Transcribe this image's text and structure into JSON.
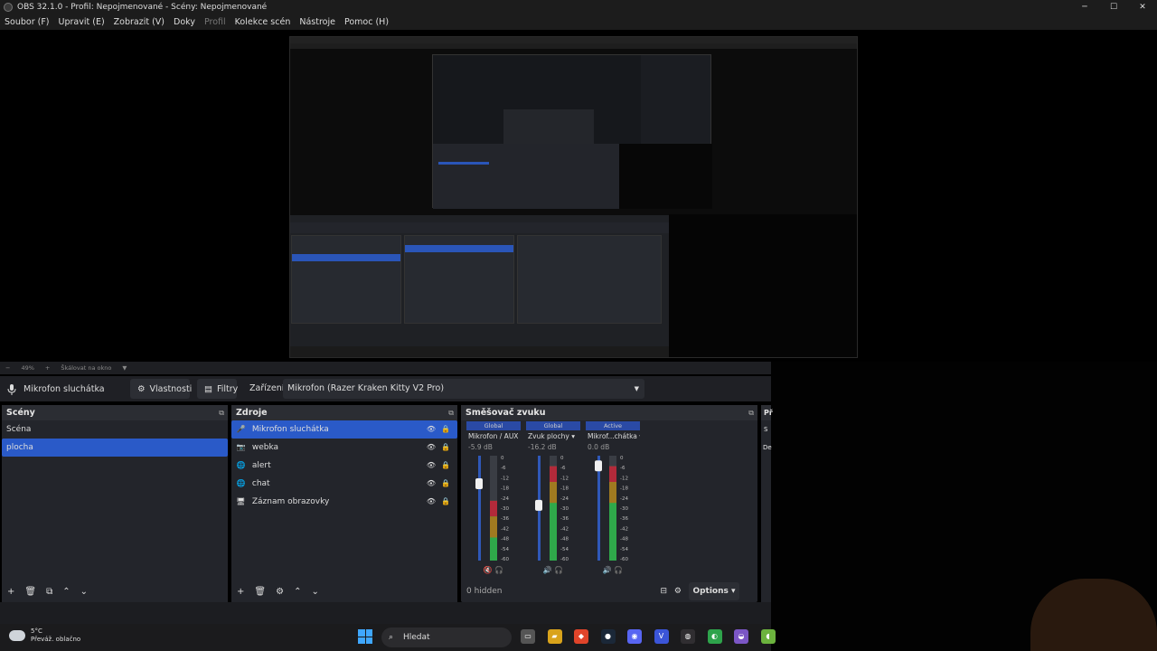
{
  "window": {
    "title": "OBS 32.1.0 - Profil: Nepojmenované - Scény: Nepojmenované",
    "controls": [
      "─",
      "☐",
      "✕"
    ]
  },
  "menu": [
    {
      "label": "Soubor (F)",
      "dim": false
    },
    {
      "label": "Upravit (E)",
      "dim": false
    },
    {
      "label": "Zobrazit (V)",
      "dim": false
    },
    {
      "label": "Doky",
      "dim": false
    },
    {
      "label": "Profil",
      "dim": true
    },
    {
      "label": "Kolekce scén",
      "dim": false
    },
    {
      "label": "Nástroje",
      "dim": false
    },
    {
      "label": "Pomoc (H)",
      "dim": false
    }
  ],
  "zoom": {
    "minus": "−",
    "value": "49%",
    "plus": "+",
    "mode": "Škálovat na okno"
  },
  "source_toolbar": {
    "selected_source": "Mikrofon sluchátka",
    "properties": "Vlastnosti",
    "filters": "Filtry",
    "device_label": "Zařízení",
    "device_value": "Mikrofon (Razer Kraken Kitty V2 Pro)"
  },
  "scenes": {
    "title": "Scény",
    "items": [
      {
        "label": "Scéna",
        "selected": false
      },
      {
        "label": "plocha",
        "selected": true
      }
    ],
    "footer": [
      "+",
      "🗑",
      "⧉",
      "⌃",
      "⌄"
    ]
  },
  "sources": {
    "title": "Zdroje",
    "items": [
      {
        "label": "Mikrofon sluchátka",
        "icon": "mic-icon",
        "glyph": "🎤",
        "selected": true
      },
      {
        "label": "webka",
        "icon": "camera-icon",
        "glyph": "📷",
        "selected": false
      },
      {
        "label": "alert",
        "icon": "browser-icon",
        "glyph": "🌐",
        "selected": false
      },
      {
        "label": "chat",
        "icon": "browser-icon",
        "glyph": "🌐",
        "selected": false
      },
      {
        "label": "Záznam obrazovky",
        "icon": "monitor-icon",
        "glyph": "🖥",
        "selected": false
      }
    ],
    "footer": [
      "+",
      "🗑",
      "⚙",
      "⌃",
      "⌄"
    ]
  },
  "mixer": {
    "title": "Směšovač zvuku",
    "channels": [
      {
        "tag": "Global",
        "name": "Mikrofon / AUX",
        "db": "-5.9 dB",
        "level": 0.57,
        "volume": 0.76,
        "muted": true
      },
      {
        "tag": "Global",
        "name": "Zvuk plochy",
        "db": "-16.2 dB",
        "level": 0.9,
        "volume": 0.53,
        "muted": false
      },
      {
        "tag": "Active",
        "name": "Mikrof...chátka",
        "db": "0.0 dB",
        "level": 0.9,
        "volume": 0.95,
        "muted": false
      }
    ],
    "scale": [
      "0",
      "-6",
      "-12",
      "-18",
      "-24",
      "-30",
      "-36",
      "-42",
      "-48",
      "-54",
      "-60"
    ],
    "hidden": "0 hidden",
    "options": "Options"
  },
  "partial_dock": {
    "title": "Př",
    "text": "S",
    "text2": "De"
  },
  "taskbar": {
    "temp": "5°C",
    "weather": "Převáž. oblačno",
    "search": "Hledat",
    "apps": [
      {
        "name": "explorer-icon",
        "glyph": "▭",
        "color": "#555"
      },
      {
        "name": "folder-icon",
        "glyph": "▰",
        "color": "#d9a31b"
      },
      {
        "name": "brave-icon",
        "glyph": "◆",
        "color": "#e0442a"
      },
      {
        "name": "steam-icon",
        "glyph": "●",
        "color": "#1b2838"
      },
      {
        "name": "discord-icon",
        "glyph": "◉",
        "color": "#5865f2"
      },
      {
        "name": "vivaldi-icon",
        "glyph": "V",
        "color": "#3b55d8"
      },
      {
        "name": "obs-icon",
        "glyph": "◍",
        "color": "#302e31"
      },
      {
        "name": "chrome-icon",
        "glyph": "◐",
        "color": "#2ea34b"
      },
      {
        "name": "edge-icon",
        "glyph": "◒",
        "color": "#7b56c5"
      },
      {
        "name": "app-icon",
        "glyph": "◖",
        "color": "#6cb33e"
      }
    ]
  }
}
